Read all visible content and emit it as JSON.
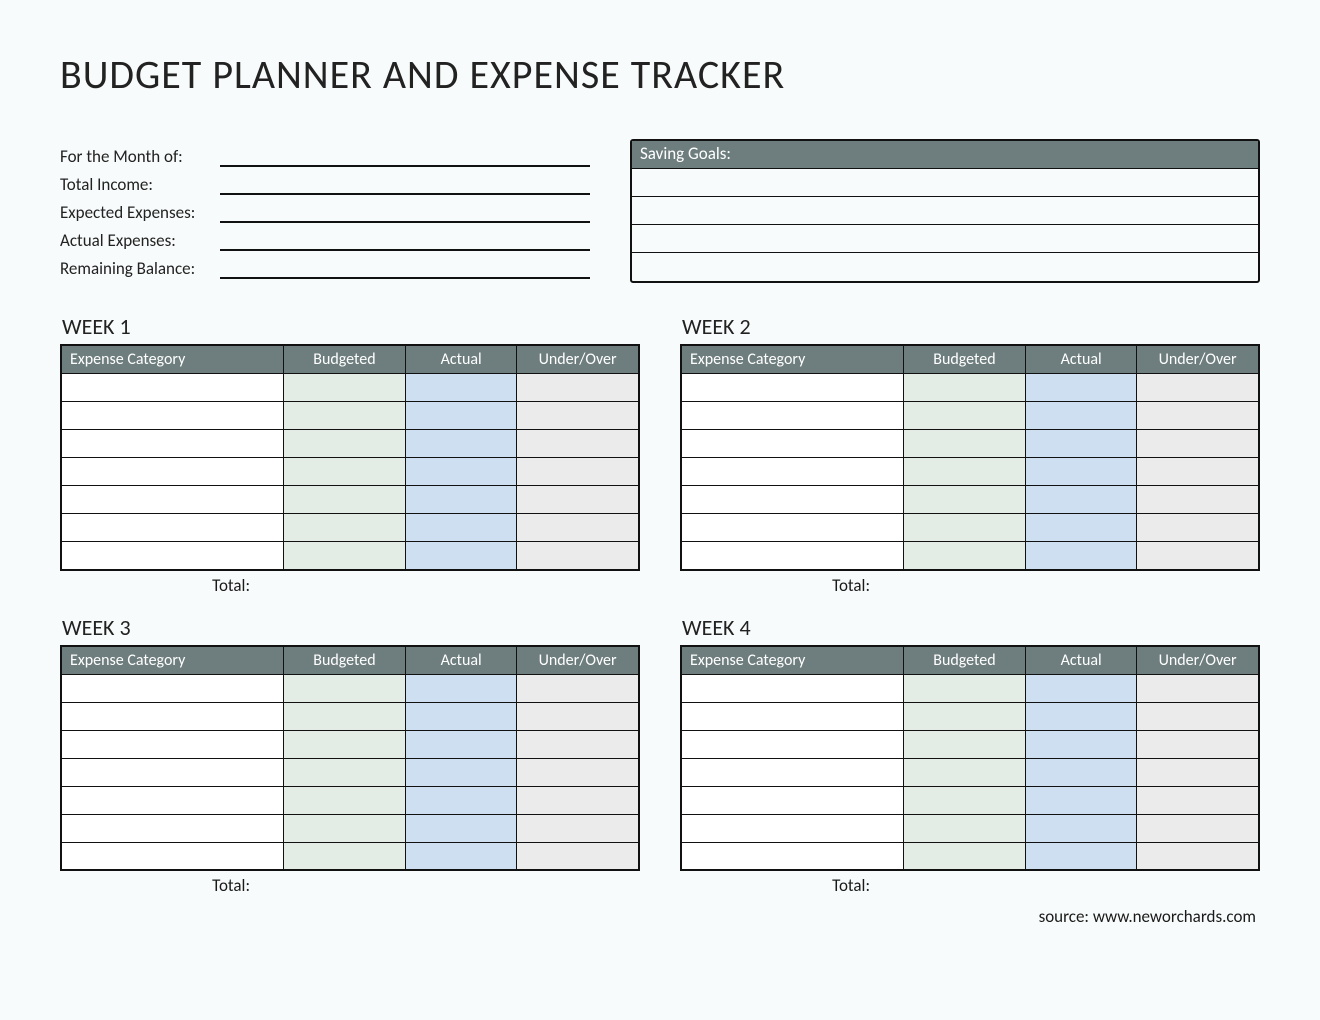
{
  "title": "BUDGET PLANNER AND EXPENSE TRACKER",
  "summary": {
    "month_label": "For the Month of:",
    "month_value": "",
    "income_label": "Total Income:",
    "income_value": "",
    "expected_label": "Expected Expenses:",
    "expected_value": "",
    "actual_label": "Actual Expenses:",
    "actual_value": "",
    "remaining_label": "Remaining Balance:",
    "remaining_value": ""
  },
  "goals": {
    "header": "Saving Goals:",
    "lines": [
      "",
      "",
      "",
      ""
    ]
  },
  "columns": {
    "category": "Expense Category",
    "budgeted": "Budgeted",
    "actual": "Actual",
    "underover": "Under/Over"
  },
  "total_label": "Total:",
  "weeks": [
    {
      "title": "WEEK 1",
      "rows": [
        {
          "category": "",
          "budgeted": "",
          "actual": "",
          "underover": ""
        },
        {
          "category": "",
          "budgeted": "",
          "actual": "",
          "underover": ""
        },
        {
          "category": "",
          "budgeted": "",
          "actual": "",
          "underover": ""
        },
        {
          "category": "",
          "budgeted": "",
          "actual": "",
          "underover": ""
        },
        {
          "category": "",
          "budgeted": "",
          "actual": "",
          "underover": ""
        },
        {
          "category": "",
          "budgeted": "",
          "actual": "",
          "underover": ""
        },
        {
          "category": "",
          "budgeted": "",
          "actual": "",
          "underover": ""
        }
      ]
    },
    {
      "title": "WEEK 2",
      "rows": [
        {
          "category": "",
          "budgeted": "",
          "actual": "",
          "underover": ""
        },
        {
          "category": "",
          "budgeted": "",
          "actual": "",
          "underover": ""
        },
        {
          "category": "",
          "budgeted": "",
          "actual": "",
          "underover": ""
        },
        {
          "category": "",
          "budgeted": "",
          "actual": "",
          "underover": ""
        },
        {
          "category": "",
          "budgeted": "",
          "actual": "",
          "underover": ""
        },
        {
          "category": "",
          "budgeted": "",
          "actual": "",
          "underover": ""
        },
        {
          "category": "",
          "budgeted": "",
          "actual": "",
          "underover": ""
        }
      ]
    },
    {
      "title": "WEEK 3",
      "rows": [
        {
          "category": "",
          "budgeted": "",
          "actual": "",
          "underover": ""
        },
        {
          "category": "",
          "budgeted": "",
          "actual": "",
          "underover": ""
        },
        {
          "category": "",
          "budgeted": "",
          "actual": "",
          "underover": ""
        },
        {
          "category": "",
          "budgeted": "",
          "actual": "",
          "underover": ""
        },
        {
          "category": "",
          "budgeted": "",
          "actual": "",
          "underover": ""
        },
        {
          "category": "",
          "budgeted": "",
          "actual": "",
          "underover": ""
        },
        {
          "category": "",
          "budgeted": "",
          "actual": "",
          "underover": ""
        }
      ]
    },
    {
      "title": "WEEK 4",
      "rows": [
        {
          "category": "",
          "budgeted": "",
          "actual": "",
          "underover": ""
        },
        {
          "category": "",
          "budgeted": "",
          "actual": "",
          "underover": ""
        },
        {
          "category": "",
          "budgeted": "",
          "actual": "",
          "underover": ""
        },
        {
          "category": "",
          "budgeted": "",
          "actual": "",
          "underover": ""
        },
        {
          "category": "",
          "budgeted": "",
          "actual": "",
          "underover": ""
        },
        {
          "category": "",
          "budgeted": "",
          "actual": "",
          "underover": ""
        },
        {
          "category": "",
          "budgeted": "",
          "actual": "",
          "underover": ""
        }
      ]
    }
  ],
  "source": "source: www.neworchards.com"
}
